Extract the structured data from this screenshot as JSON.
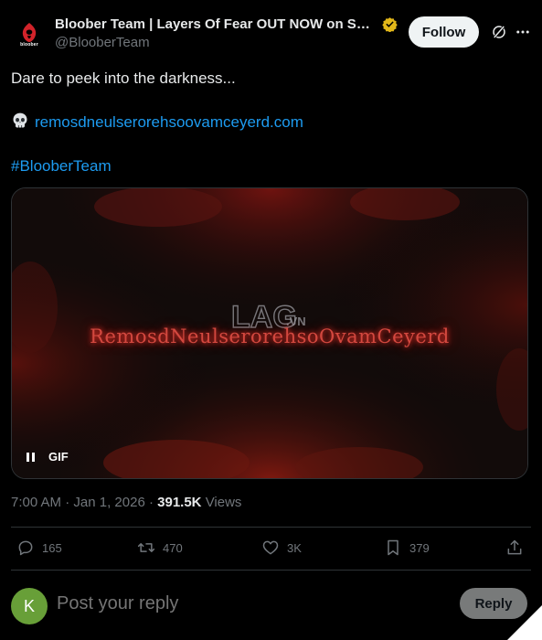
{
  "header": {
    "display_name": "Bloober Team | Layers Of Fear OUT NOW on Swit...",
    "handle": "@BlooberTeam",
    "avatar_text": "bloober",
    "follow_label": "Follow"
  },
  "tweet": {
    "line1": "Dare to peek into the darkness...",
    "link": "remosdneulserorehsoovamceyerd.com",
    "hashtag": "#BlooberTeam"
  },
  "media": {
    "overlay_text": "RemosdNeulserorehsoOvamCeyerd",
    "gif_label": "GIF",
    "watermark": "LAG.vn"
  },
  "meta": {
    "time": "7:00 AM",
    "date": "Jan 1, 2026",
    "views_count": "391.5K",
    "views_label": "Views"
  },
  "actions": {
    "replies": "165",
    "reposts": "470",
    "likes": "3K",
    "bookmarks": "379"
  },
  "reply": {
    "avatar_letter": "K",
    "placeholder": "Post your reply",
    "button_label": "Reply"
  },
  "colors": {
    "accent": "#1d9bf0",
    "verified": "#e2b719",
    "reply_avatar": "#689f38"
  }
}
